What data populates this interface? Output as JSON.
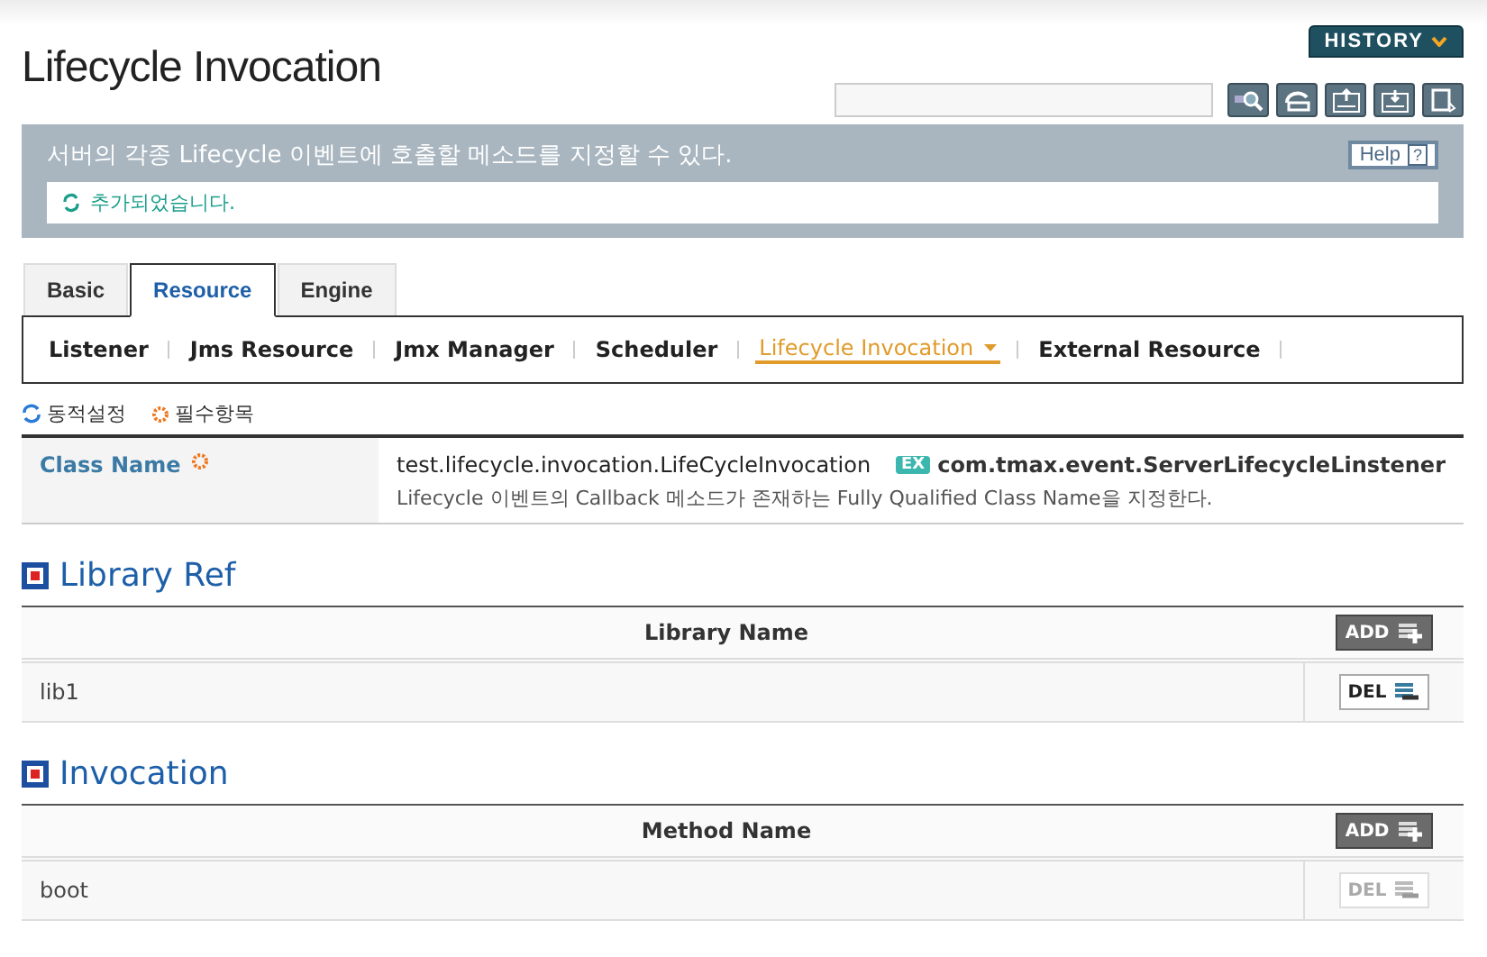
{
  "history_button": {
    "label": "HISTORY"
  },
  "title": "Lifecycle Invocation",
  "banner": {
    "description": "서버의 각종 Lifecycle 이벤트에 호출할 메소드를 지정할 수 있다.",
    "help": "Help",
    "help_mark": "?",
    "message": "추가되었습니다."
  },
  "tabs": [
    {
      "label": "Basic",
      "selected": false
    },
    {
      "label": "Resource",
      "selected": true
    },
    {
      "label": "Engine",
      "selected": false
    }
  ],
  "subnav": [
    {
      "label": "Listener",
      "selected": false
    },
    {
      "label": "Jms Resource",
      "selected": false
    },
    {
      "label": "Jmx Manager",
      "selected": false
    },
    {
      "label": "Scheduler",
      "selected": false
    },
    {
      "label": "Lifecycle Invocation",
      "selected": true
    },
    {
      "label": "External Resource",
      "selected": false
    }
  ],
  "legend": {
    "dynamic": "동적설정",
    "required": "필수항목"
  },
  "class_name": {
    "label": "Class Name",
    "required": true,
    "value": "test.lifecycle.invocation.LifeCycleInvocation",
    "example_badge": "EX",
    "example": "com.tmax.event.ServerLifecycleLinstener",
    "help": "Lifecycle 이벤트의 Callback 메소드가 존재하는 Fully Qualified Class Name을 지정한다."
  },
  "sections": [
    {
      "title": "Library Ref",
      "column": "Library Name",
      "add": "ADD",
      "rows": [
        {
          "value": "lib1",
          "delete": "DEL",
          "disabled": false
        }
      ]
    },
    {
      "title": "Invocation",
      "column": "Method Name",
      "add": "ADD",
      "rows": [
        {
          "value": "boot",
          "delete": "DEL",
          "disabled": true
        }
      ]
    }
  ]
}
